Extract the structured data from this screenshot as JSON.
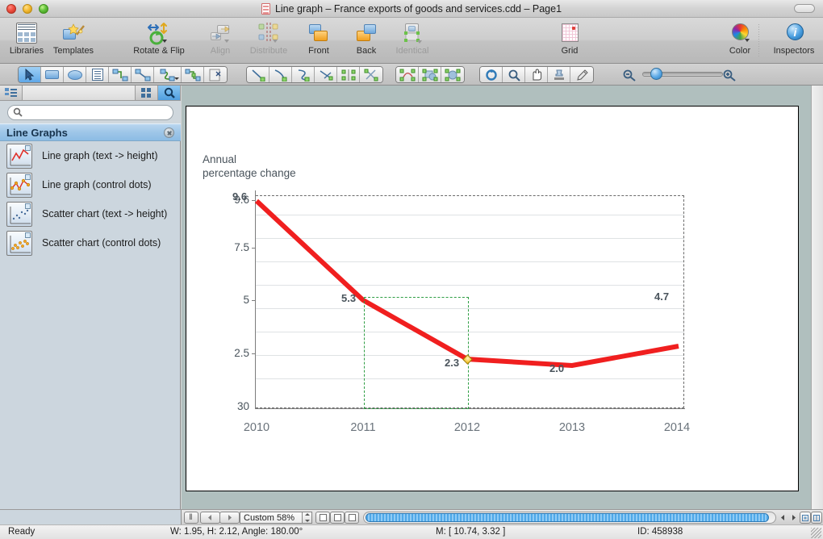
{
  "window": {
    "title": "Line graph – France exports of goods and services.cdd – Page1",
    "doc_icon": "document-icon",
    "close_button": "close",
    "minimize_button": "minimize",
    "zoom_button": "zoom"
  },
  "toolbar": {
    "items": [
      {
        "label": "Libraries",
        "icon": "libraries-icon",
        "enabled": true
      },
      {
        "label": "Templates",
        "icon": "templates-icon",
        "enabled": true
      },
      {
        "label": "Rotate & Flip",
        "icon": "rotate-flip-icon",
        "enabled": true
      },
      {
        "label": "Align",
        "icon": "align-icon",
        "enabled": false
      },
      {
        "label": "Distribute",
        "icon": "distribute-icon",
        "enabled": false
      },
      {
        "label": "Front",
        "icon": "bring-front-icon",
        "enabled": true
      },
      {
        "label": "Back",
        "icon": "send-back-icon",
        "enabled": true
      },
      {
        "label": "Identical",
        "icon": "identical-icon",
        "enabled": false
      },
      {
        "label": "Grid",
        "icon": "grid-icon",
        "enabled": true
      },
      {
        "label": "Color",
        "icon": "color-wheel-icon",
        "enabled": true
      },
      {
        "label": "Inspectors",
        "icon": "info-icon",
        "enabled": true
      }
    ]
  },
  "toolstrip": {
    "group1": [
      "pointer-icon",
      "rectangle-icon",
      "ellipse-icon",
      "text-icon",
      "connector-elbow-icon",
      "connector-straight-icon",
      "connector-curved-icon",
      "connector-tree-icon",
      "mask-icon"
    ],
    "group2": [
      "line-icon",
      "arc-icon",
      "curve-icon",
      "polyline-icon",
      "mirror-icon",
      "scissors-icon"
    ],
    "group3": [
      "bezier-edit-icon",
      "union-shapes-icon",
      "group-shapes-icon"
    ],
    "group4": [
      "rotate-tool-icon",
      "zoom-tool-icon",
      "hand-tool-icon",
      "stamp-tool-icon",
      "eyedropper-icon"
    ],
    "zoom_out_icon": "zoom-out-icon",
    "zoom_in_icon": "zoom-in-icon"
  },
  "sidebar": {
    "view_outline_icon": "outline-view-icon",
    "view_grid_icon": "grid-view-icon",
    "view_search_icon": "search-view-icon",
    "search_placeholder": "",
    "search_value": "",
    "group_title": "Line Graphs",
    "group_close_icon": "close-circle-icon",
    "items": [
      {
        "label": "Line graph (text -> height)",
        "icon": "line-graph-text-thumb"
      },
      {
        "label": "Line graph (control dots)",
        "icon": "line-graph-dots-thumb"
      },
      {
        "label": "Scatter chart (text -> height)",
        "icon": "scatter-text-thumb"
      },
      {
        "label": "Scatter chart (control dots)",
        "icon": "scatter-dots-thumb"
      }
    ]
  },
  "chart_data": {
    "type": "line",
    "title": "Annual\npercentage change",
    "xlabel": "",
    "ylabel": "Annual percentage change",
    "categories": [
      "2010",
      "2011",
      "2012",
      "2013",
      "2014"
    ],
    "values": [
      9.6,
      5.3,
      2.3,
      2.0,
      4.7
    ],
    "point_labels": [
      "9.6",
      "5.3",
      "2.3",
      "2.0",
      "4.7"
    ],
    "y_ticks": [
      "9.6",
      "7.5",
      "5",
      "2.5",
      "30"
    ],
    "y_tick_values": [
      9.6,
      7.5,
      5,
      2.5,
      0
    ],
    "ylim": [
      0,
      10.3
    ],
    "grid": true,
    "gridlines_count": 9,
    "legend": "none",
    "series_color": "#f01f1f",
    "line_width": 6,
    "label_color": "#4a545c",
    "axis_color": "#7d7d7d",
    "grid_color": "#dfe2e4",
    "selection_color": "#2f9e44",
    "handle_color": "#f0b400",
    "selected_point": "2.3"
  },
  "bottombar": {
    "pause_icon": "pause-icon",
    "prev_page_icon": "prev-page-icon",
    "next_page_icon": "next-page-icon",
    "zoom_value": "Custom 58%",
    "stepper_icon": "stepper-icon",
    "page_view_icons": [
      "page-view-1",
      "page-view-2",
      "page-view-3"
    ],
    "scroll_left_icon": "scroll-left-icon",
    "scroll_right_icon": "scroll-right-icon",
    "fit_icon": "fit-page-icon",
    "split_icon": "split-view-icon"
  },
  "status": {
    "state": "Ready",
    "dimensions": "W: 1.95,  H: 2.12,  Angle: 180.00°",
    "mouse": "M: [ 10.74, 3.32 ]",
    "id": "ID: 458938"
  }
}
